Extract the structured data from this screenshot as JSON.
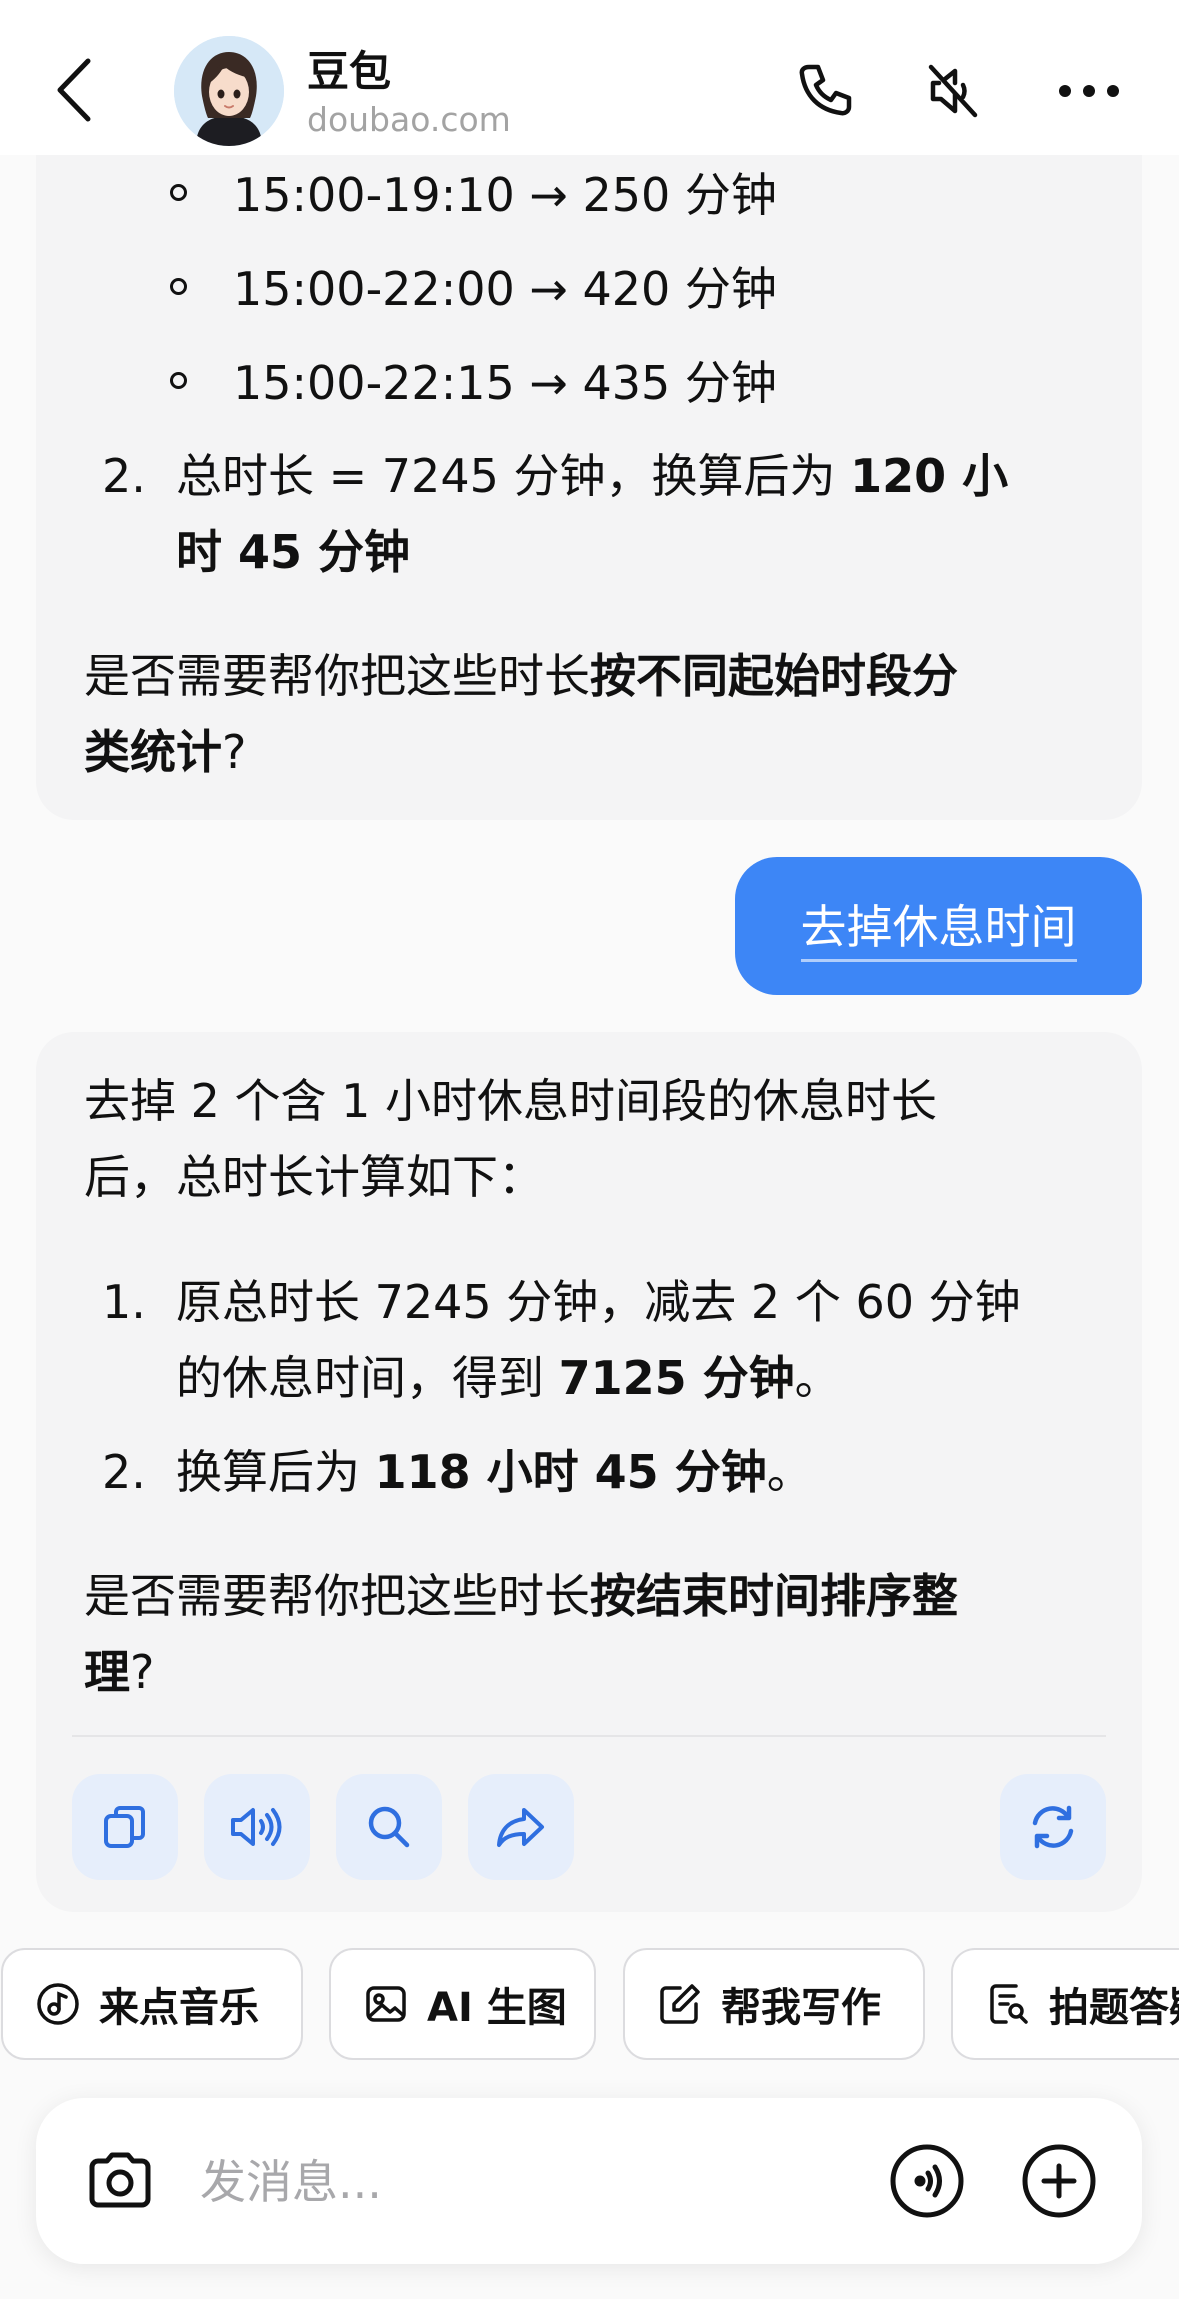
{
  "header": {
    "title": "豆包",
    "subtitle": "doubao.com"
  },
  "message1": {
    "sub_items": [
      "15:00-19:10 → 250 分钟",
      "15:00-22:00 → 420 分钟",
      "15:00-22:15 → 435 分钟"
    ],
    "item2_num": "2.",
    "item2_line1_pre": "总时长 = 7245 分钟，换算后为 ",
    "item2_line1_bold": "120 小",
    "item2_line2_bold": "时 45 分钟",
    "question_line1_pre": "是否需要帮你把这些时长",
    "question_line1_bold": "按不同起始时段分",
    "question_line2_bold": "类统计",
    "question_line2_post": "?"
  },
  "user_message": "去掉休息时间",
  "message2": {
    "intro_line1": "去掉 2 个含 1 小时休息时间段的休息时长",
    "intro_line2": "后，总时长计算如下：",
    "item1_num": "1.",
    "item1_line1": "原总时长 7245 分钟，减去 2 个 60 分钟",
    "item1_line2_pre": "的休息时间，得到 ",
    "item1_line2_bold": "7125 分钟",
    "item1_line2_post": "。",
    "item2_num": "2.",
    "item2_pre": "换算后为 ",
    "item2_bold": "118 小时 45 分钟",
    "item2_post": "。",
    "question_line1_pre": "是否需要帮你把这些时长",
    "question_line1_bold": "按结束时间排序整",
    "question_line2_bold": "理",
    "question_line2_post": "?"
  },
  "actions": [
    "copy-icon",
    "speaker-icon",
    "search-icon",
    "share-icon",
    "regenerate-icon"
  ],
  "quick_chips": [
    {
      "label": "来点音乐",
      "icon": "music-icon"
    },
    {
      "label": "AI 生图",
      "icon": "image-icon"
    },
    {
      "label": "帮我写作",
      "icon": "edit-icon"
    },
    {
      "label": "拍题答疑",
      "icon": "photo-search-icon"
    }
  ],
  "input": {
    "placeholder": "发消息..."
  },
  "colors": {
    "accent": "#3d86f6",
    "bubble_bg": "#f4f4f5",
    "action_bg": "#e6eefb"
  }
}
